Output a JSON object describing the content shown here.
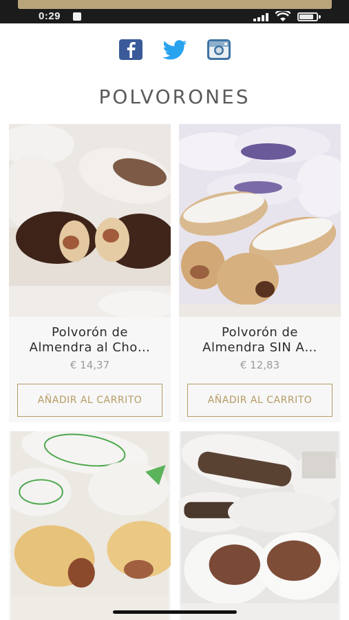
{
  "status_bar": {
    "time": "0:29",
    "icons": [
      "signal-icon",
      "wifi-icon",
      "battery-icon"
    ],
    "battery_level": 0.78
  },
  "social": {
    "items": [
      {
        "name": "facebook-icon",
        "color": "#3b5a9a"
      },
      {
        "name": "twitter-icon",
        "color": "#2aa3ef"
      },
      {
        "name": "instagram-icon",
        "color": "#3f73a3"
      }
    ]
  },
  "section": {
    "title": "POLVORONES"
  },
  "products": [
    {
      "name_line1": "Polvorón de",
      "name_line2": "Almendra al Cho…",
      "price": "€ 14,37",
      "button": "AÑADIR AL CARRITO",
      "image": "chocolate-polvoron-photo"
    },
    {
      "name_line1": "Polvorón de",
      "name_line2": "Almendra SIN A…",
      "price": "€ 12,83",
      "button": "AÑADIR AL CARRITO",
      "image": "sugar-free-polvoron-photo"
    },
    {
      "image": "olive-oil-polvoron-photo"
    },
    {
      "image": "white-chocolate-polvoron-photo"
    }
  ],
  "colors": {
    "accent_gold": "#b59a63",
    "title_gray": "#5a5a5a",
    "price_gray": "#9b9b9b",
    "card_bg": "#f7f7f7"
  }
}
